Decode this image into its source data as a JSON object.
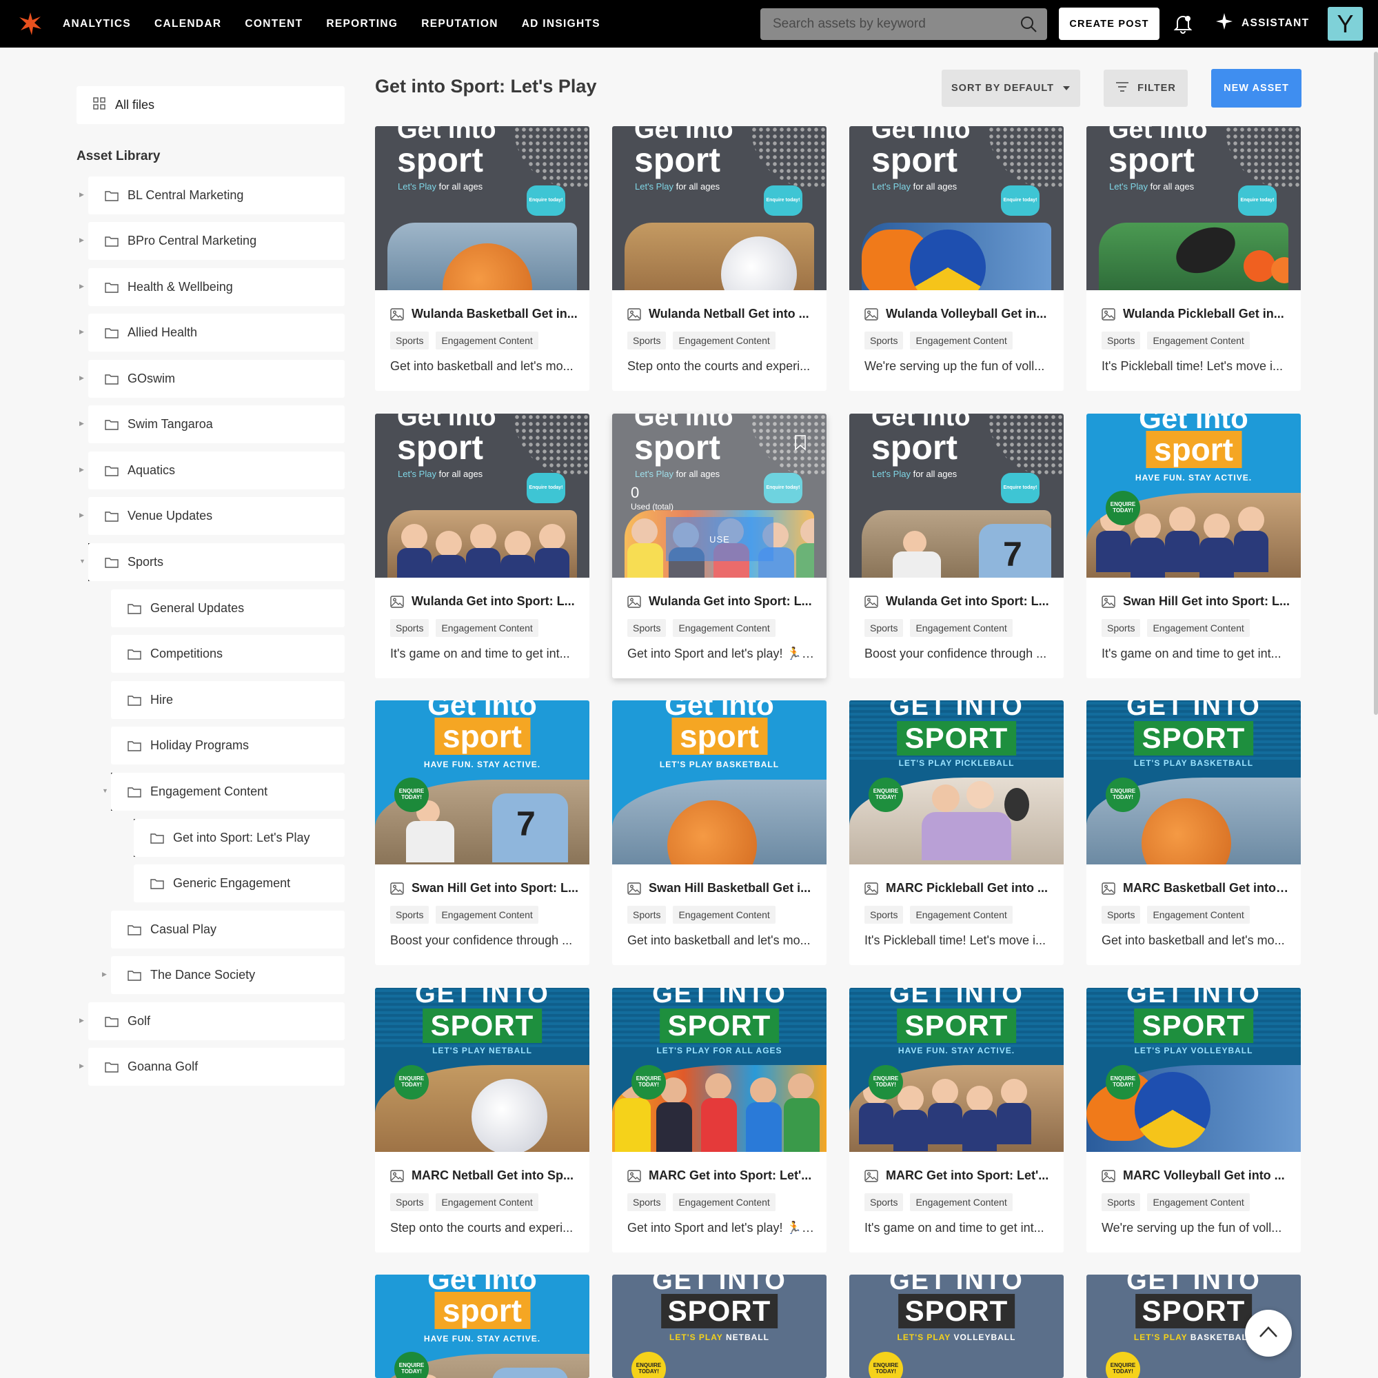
{
  "nav": {
    "items": [
      "ANALYTICS",
      "CALENDAR",
      "CONTENT",
      "REPORTING",
      "REPUTATION",
      "AD INSIGHTS"
    ],
    "search_placeholder": "Search assets by keyword",
    "create_post": "CREATE POST",
    "assistant": "ASSISTANT",
    "avatar_letter": "Y"
  },
  "sidebar": {
    "all_files": "All files",
    "library_title": "Asset Library",
    "folders": [
      {
        "label": "BL Central Marketing"
      },
      {
        "label": "BPro Central Marketing"
      },
      {
        "label": "Health & Wellbeing"
      },
      {
        "label": "Allied Health"
      },
      {
        "label": "GOswim"
      },
      {
        "label": "Swim Tangaroa"
      },
      {
        "label": "Aquatics"
      },
      {
        "label": "Venue Updates"
      },
      {
        "label": "Sports"
      },
      {
        "label": "General Updates"
      },
      {
        "label": "Competitions"
      },
      {
        "label": "Hire"
      },
      {
        "label": "Holiday Programs"
      },
      {
        "label": "Engagement Content"
      },
      {
        "label": "Get into Sport: Let's Play"
      },
      {
        "label": "Generic Engagement"
      },
      {
        "label": "Casual Play"
      },
      {
        "label": "The Dance Society"
      },
      {
        "label": "Golf"
      },
      {
        "label": "Goanna Golf"
      }
    ]
  },
  "main": {
    "title": "Get into Sport: Let's Play",
    "sort_label": "SORT BY DEFAULT",
    "filter_label": "FILTER",
    "new_asset_label": "NEW ASSET",
    "tag1": "Sports",
    "tag2": "Engagement Content",
    "cards": [
      {
        "title": "Wulanda Basketball Get in...",
        "desc": "Get into basketball and let's mo..."
      },
      {
        "title": "Wulanda Netball Get into ...",
        "desc": "Step onto the courts and experi..."
      },
      {
        "title": "Wulanda Volleyball Get in...",
        "desc": "We're serving up the fun of voll..."
      },
      {
        "title": "Wulanda Pickleball Get in...",
        "desc": "It's Pickleball time! Let's move i..."
      },
      {
        "title": "Wulanda Get into Sport: L...",
        "desc": "It's game on and time to get int..."
      },
      {
        "title": "Wulanda Get into Sport: L...",
        "desc": "Get into Sport and let's play! 🏃 ..."
      },
      {
        "title": "Wulanda Get into Sport: L...",
        "desc": "Boost your confidence through ..."
      },
      {
        "title": "Swan Hill Get into Sport: L...",
        "desc": "It's game on and time to get int..."
      },
      {
        "title": "Swan Hill Get into Sport: L...",
        "desc": "Boost your confidence through ..."
      },
      {
        "title": "Swan Hill Basketball Get i...",
        "desc": "Get into basketball and let's mo..."
      },
      {
        "title": "MARC Pickleball Get into ...",
        "desc": "It's Pickleball time! Let's move i..."
      },
      {
        "title": "MARC Basketball Get into ...",
        "desc": "Get into basketball and let's mo..."
      },
      {
        "title": "MARC Netball Get into Sp...",
        "desc": "Step onto the courts and experi..."
      },
      {
        "title": "MARC Get into Sport: Let'...",
        "desc": "Get into Sport and let's play! 🏃 ..."
      },
      {
        "title": "MARC Get into Sport: Let'...",
        "desc": "It's game on and time to get int..."
      },
      {
        "title": "MARC Volleyball Get into ...",
        "desc": "We're serving up the fun of voll..."
      }
    ],
    "thumb_text": {
      "get_into": "Get into",
      "sport": "sport",
      "lets_play": "Let's Play",
      "for_all_ages": "for all ages",
      "enquire": "Enquire today!",
      "have_fun": "HAVE FUN. STAY ACTIVE.",
      "lets_play_basketball": "LET'S PLAY BASKETBALL",
      "GET_INTO": "GET INTO",
      "SPORT": "SPORT",
      "lets_play_pickleball": "LET'S PLAY PICKLEBALL",
      "lets_play_netball": "LET'S PLAY NETBALL",
      "lets_play_for_all_ages": "LET'S PLAY FOR ALL AGES",
      "lets_play_volleyball": "LET'S PLAY VOLLEYBALL",
      "lets_play_caps": "LET'S PLAY",
      "netball": "NETBALL",
      "volleyball": "VOLLEYBALL",
      "basketball": "BASKETBALL",
      "enquire_caps": "ENQUIRE TODAY!"
    },
    "hover_card": {
      "used_count": "0",
      "used_label": "Used (total)",
      "use_button": "USE"
    }
  }
}
